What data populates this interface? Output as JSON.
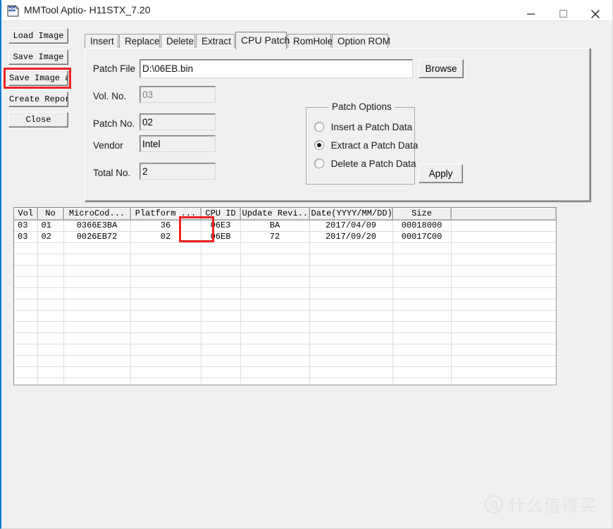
{
  "window": {
    "title": "MMTool Aptio- H11STX_7.20",
    "icon": "mm-document-icon",
    "controls": {
      "minimize": "minimize-icon",
      "maximize": "maximize-icon",
      "close": "close-icon"
    }
  },
  "sidebar": {
    "buttons": [
      {
        "id": "load-image",
        "label": "Load Image"
      },
      {
        "id": "save-image",
        "label": "Save Image"
      },
      {
        "id": "save-image-as",
        "label": "Save Image as."
      },
      {
        "id": "create-report",
        "label": "Create Report"
      },
      {
        "id": "close",
        "label": "Close"
      }
    ]
  },
  "tabs": {
    "items": [
      {
        "label": "Insert",
        "active": false
      },
      {
        "label": "Replace",
        "active": false
      },
      {
        "label": "Delete",
        "active": false
      },
      {
        "label": "Extract",
        "active": false
      },
      {
        "label": "CPU Patch",
        "active": true
      },
      {
        "label": "RomHole",
        "active": false
      },
      {
        "label": "Option ROM",
        "active": false
      }
    ]
  },
  "form": {
    "patch_file_label": "Patch File",
    "patch_file_value": "D:\\06EB.bin",
    "browse_label": "Browse",
    "vol_no_label": "Vol. No.",
    "vol_no_value": "03",
    "patch_no_label": "Patch No.",
    "patch_no_value": "02",
    "vendor_label": "Vendor",
    "vendor_value": "Intel",
    "total_no_label": "Total No.",
    "total_no_value": "2"
  },
  "patch_options": {
    "title": "Patch Options",
    "options": [
      {
        "label": "Insert a Patch Data",
        "checked": false
      },
      {
        "label": "Extract a Patch Data",
        "checked": true
      },
      {
        "label": "Delete a Patch Data",
        "checked": false
      }
    ],
    "apply_label": "Apply"
  },
  "grid": {
    "columns": [
      "Vol",
      "No",
      "MicroCod...",
      "Platform ...",
      "CPU ID",
      "Update Revi...",
      "Date(YYYY/MM/DD)",
      "Size",
      ""
    ],
    "rows": [
      [
        "03",
        "01",
        "0366E3BA",
        "36",
        "06E3",
        "BA",
        "2017/04/09",
        "00018000",
        ""
      ],
      [
        "03",
        "02",
        "0026EB72",
        "02",
        "06EB",
        "72",
        "2017/09/20",
        "00017C00",
        ""
      ]
    ],
    "empty_row_count": 14
  },
  "annotations": {
    "highlight_color": "#ee2222",
    "boxes": [
      {
        "name": "save-image-as-highlight"
      },
      {
        "name": "cpu-id-column-highlight"
      }
    ]
  },
  "watermark": {
    "logo_char": "值",
    "text": "什么值得买"
  }
}
